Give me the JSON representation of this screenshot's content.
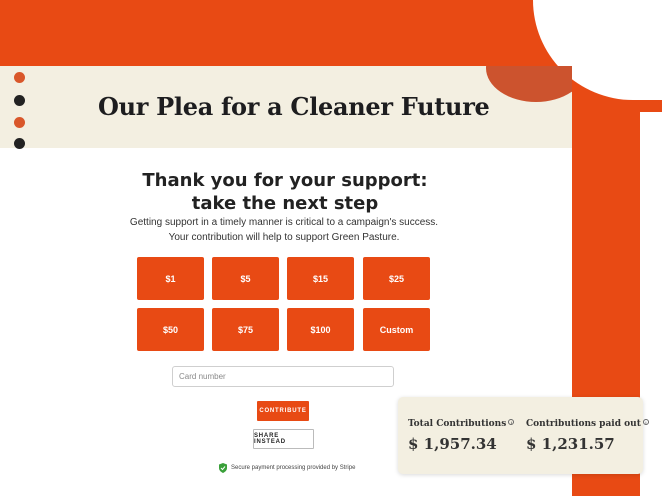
{
  "page": {
    "title": "Our Plea for a Cleaner Future"
  },
  "form": {
    "heading": "Thank you for your support: take the next step",
    "description_line1": "Getting support in a timely manner is critical to a campaign's success.",
    "description_line2": "Your contribution will help to support Green Pasture.",
    "amounts": [
      "$1",
      "$5",
      "$15",
      "$25",
      "$50",
      "$75",
      "$100",
      "Custom"
    ],
    "card_placeholder": "Card number",
    "contribute_label": "CONTRIBUTE",
    "share_label": "SHARE INSTEAD",
    "secure_text": "Secure payment processing provided by Stripe"
  },
  "stats": {
    "total_label": "Total Contributions",
    "total_value": "$ 1,957.34",
    "paid_label": "Contributions paid out",
    "paid_value": "$ 1,231.57",
    "info_icon": "info-icon"
  },
  "colors": {
    "brand": "#e84a14",
    "cream": "#f3efe1",
    "dot_orange": "#d9572a",
    "dot_dark": "#222222",
    "shield": "#3aa03a"
  }
}
